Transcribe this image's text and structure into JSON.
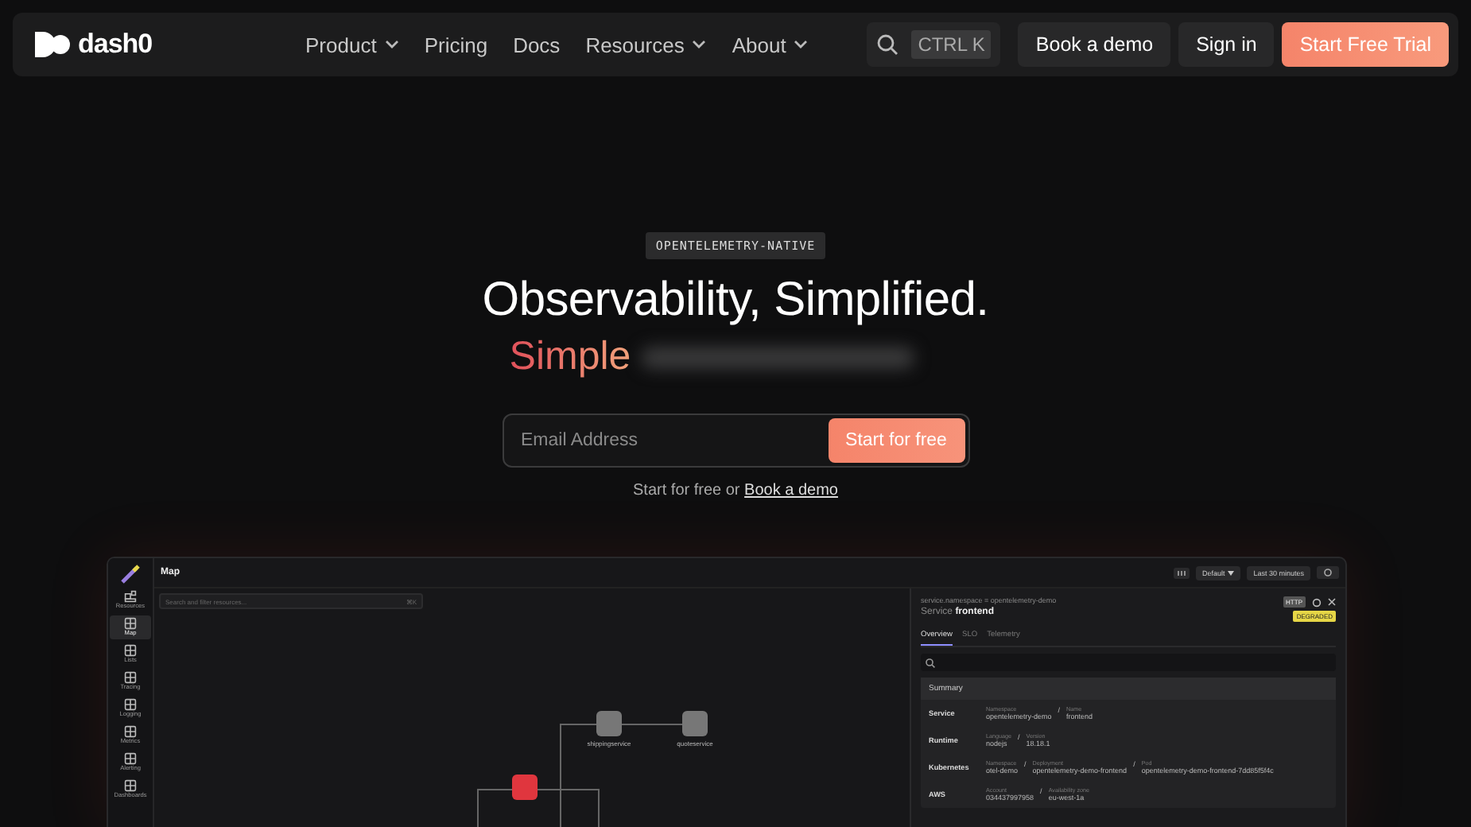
{
  "nav": {
    "logo": "dash0",
    "links": [
      {
        "label": "Product",
        "dropdown": true
      },
      {
        "label": "Pricing",
        "dropdown": false
      },
      {
        "label": "Docs",
        "dropdown": false
      },
      {
        "label": "Resources",
        "dropdown": true
      },
      {
        "label": "About",
        "dropdown": true
      }
    ],
    "search_shortcut": "CTRL K",
    "buttons": [
      {
        "label": "Book a demo",
        "kind": "secondary"
      },
      {
        "label": "Sign in",
        "kind": "secondary"
      },
      {
        "label": "Start Free Trial",
        "kind": "primary"
      }
    ]
  },
  "hero": {
    "badge": "OPENTELEMETRY-NATIVE",
    "title": "Observability, Simplified.",
    "subtitle": "Simple",
    "email": {
      "placeholder": "Email Address",
      "button": "Start for free"
    },
    "note": {
      "text": "Start for free or",
      "link": "Book a demo"
    }
  },
  "app": {
    "title": "Map",
    "sidebar": [
      {
        "label": "Resources",
        "selected": false
      },
      {
        "label": "Map",
        "selected": true
      },
      {
        "label": "Lists",
        "selected": false
      },
      {
        "label": "Tracing",
        "selected": false
      },
      {
        "label": "Logging",
        "selected": false
      },
      {
        "label": "Metrics",
        "selected": false
      },
      {
        "label": "Alerting",
        "selected": false
      },
      {
        "label": "Dashboards",
        "selected": false
      }
    ],
    "search": {
      "placeholder": "Search and filter resources...",
      "shortcut": "⌘K"
    },
    "toolbar": {
      "filter": "Default",
      "time": "Last 30 minutes"
    },
    "nodes": [
      {
        "label": "shippingservice",
        "color": "#777777"
      },
      {
        "label": "quoteservice",
        "color": "#777777"
      },
      {
        "color": "#e0363e"
      }
    ],
    "panel": {
      "breadcrumb": "service.namespace = opentelemetry-demo",
      "type": "Service",
      "name": "frontend",
      "protocol": "HTTP",
      "status": "DEGRADED",
      "tabs": [
        {
          "label": "Overview",
          "selected": true
        },
        {
          "label": "SLO",
          "selected": false
        },
        {
          "label": "Telemetry",
          "selected": false
        }
      ],
      "section": "Summary",
      "rows": [
        {
          "label": "Service",
          "fields": [
            {
              "key": "Namespace",
              "value": "opentelemetry-demo"
            },
            {
              "separator": "/",
              "key": "Name",
              "value": "frontend"
            }
          ]
        },
        {
          "label": "Runtime",
          "fields": [
            {
              "key": "Language",
              "value": "nodejs"
            },
            {
              "separator": "/",
              "key": "Version",
              "value": "18.18.1"
            }
          ]
        },
        {
          "label": "Kubernetes",
          "fields": [
            {
              "key": "Namespace",
              "value": "otel-demo"
            },
            {
              "separator": "/",
              "key": "Deployment",
              "value": "opentelemetry-demo-frontend"
            },
            {
              "separator": "/",
              "key": "Pod",
              "value": "opentelemetry-demo-frontend-7dd85f5f4c"
            }
          ]
        },
        {
          "label": "AWS",
          "fields": [
            {
              "key": "Account",
              "value": "034437997958"
            },
            {
              "separator": "/",
              "key": "Availability zone",
              "value": "eu-west-1a"
            }
          ]
        }
      ]
    }
  }
}
